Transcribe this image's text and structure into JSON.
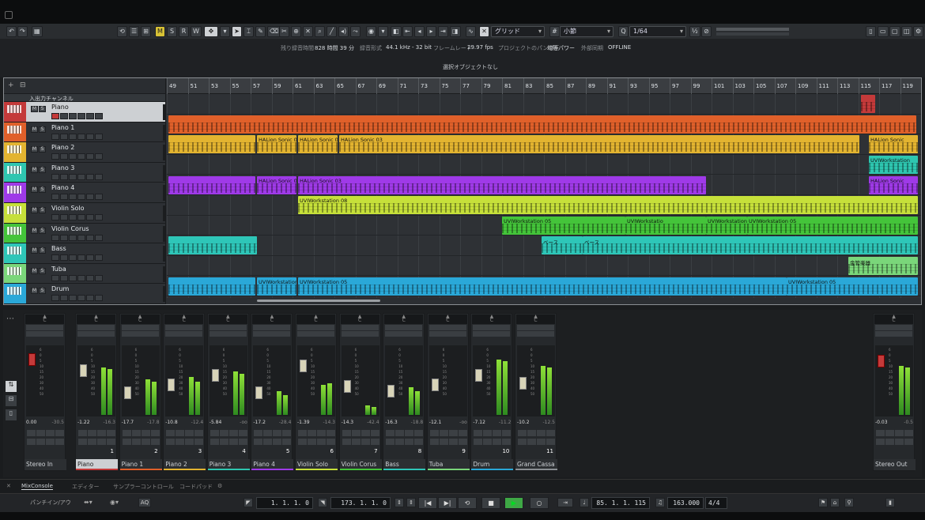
{
  "toolbar": {
    "mode_m": "M",
    "mode_s": "S",
    "mode_r": "R",
    "mode_w": "W",
    "snap_type": "グリッド",
    "grid_type": "小節",
    "quantize": "1/64"
  },
  "info": {
    "rec_time_label": "残り録音時間",
    "rec_time_value": "828 時間 39 分",
    "rec_format_label": "録音形式",
    "rec_format_value": "44.1 kHz - 32 bit",
    "frame_rate_label": "フレームレート",
    "frame_rate_value": "29.97 fps",
    "pan_label": "プロジェクトのパン補正",
    "pan_value": "均等パワー",
    "sync_label": "外部同期",
    "sync_value": "OFFLINE"
  },
  "status": {
    "message": "選択オブジェクトなし"
  },
  "project": {
    "folder_label": "入出力チャンネル",
    "tracks": [
      {
        "name": "Piano",
        "color": "#c43a3a"
      },
      {
        "name": "Piano 1",
        "color": "#e0602a"
      },
      {
        "name": "Piano 2",
        "color": "#e3b430"
      },
      {
        "name": "Piano 3",
        "color": "#2ec6b0"
      },
      {
        "name": "Piano 4",
        "color": "#9f3ae8"
      },
      {
        "name": "Violin Solo",
        "color": "#c6e03a"
      },
      {
        "name": "Violin Corus",
        "color": "#44c43a"
      },
      {
        "name": "Bass",
        "color": "#2ec6b8"
      },
      {
        "name": "Tuba",
        "color": "#7ad67a"
      },
      {
        "name": "Drum",
        "color": "#2aa8d8"
      }
    ],
    "bars": [
      "49",
      "51",
      "53",
      "55",
      "57",
      "59",
      "61",
      "63",
      "65",
      "67",
      "69",
      "71",
      "73",
      "75",
      "77",
      "79",
      "81",
      "83",
      "85",
      "87",
      "89",
      "91",
      "93",
      "95",
      "97",
      "99",
      "101",
      "103",
      "105",
      "107",
      "109",
      "111",
      "113",
      "115",
      "117",
      "119"
    ],
    "event_labels": {
      "halion0": "HALion Sonic 0",
      "halion03": "HALion Sonic 03",
      "halion0short": "HALion Sonic 0",
      "halionsonic": "HALion Sonic",
      "uvi08": "UVIWorkstation 08",
      "uvi05": "UVIWorkstation 05",
      "uvi05b": "UVIWorkstatio",
      "uvi05c": "UVIWorkstation 05",
      "uvi05d": "UVIWorkstation 05",
      "uvi_cut": "UVIWorkstation",
      "bass1": "ベース",
      "bass2": "ベース",
      "tuba": "金管楽器"
    }
  },
  "mixer": {
    "strips": [
      {
        "name": "Stereo In",
        "num": "",
        "val": "0.00",
        "peak": "-30.5",
        "color": "#2c2f32",
        "textcolor": "#aaa"
      },
      {
        "name": "Piano",
        "num": "1",
        "val": "-1.22",
        "peak": "-16.3",
        "color": "#cdd0d3",
        "bar": "#c43a3a"
      },
      {
        "name": "Piano 1",
        "num": "2",
        "val": "-17.7",
        "peak": "-17.8",
        "color": "#2c2f32",
        "bar": "#e0602a"
      },
      {
        "name": "Piano 2",
        "num": "3",
        "val": "-10.8",
        "peak": "-12.4",
        "color": "#2c2f32",
        "bar": "#e3b430"
      },
      {
        "name": "Piano 3",
        "num": "4",
        "val": "-5.84",
        "peak": "-oo",
        "color": "#2c2f32",
        "bar": "#2ec6b0"
      },
      {
        "name": "Piano 4",
        "num": "5",
        "val": "-17.2",
        "peak": "-28.4",
        "color": "#2c2f32",
        "bar": "#9f3ae8"
      },
      {
        "name": "Violin Solo",
        "num": "6",
        "val": "-1.39",
        "peak": "-14.3",
        "color": "#2c2f32",
        "bar": "#c6e03a"
      },
      {
        "name": "Violin Corus",
        "num": "7",
        "val": "-14.3",
        "peak": "-42.4",
        "color": "#2c2f32",
        "bar": "#44c43a"
      },
      {
        "name": "Bass",
        "num": "8",
        "val": "-16.3",
        "peak": "-18.8",
        "color": "#2c2f32",
        "bar": "#2ec6b8"
      },
      {
        "name": "Tuba",
        "num": "9",
        "val": "-12.1",
        "peak": "-oo",
        "color": "#2c2f32",
        "bar": "#7ad67a"
      },
      {
        "name": "Drum",
        "num": "10",
        "val": "-7.12",
        "peak": "-11.2",
        "color": "#2c2f32",
        "bar": "#2aa8d8"
      },
      {
        "name": "Grand Cassa",
        "num": "11",
        "val": "-10.2",
        "peak": "-12.5",
        "color": "#2c2f32",
        "bar": "#8a8e92"
      }
    ],
    "out": {
      "name": "Stereo Out",
      "val": "-0.03",
      "peak": "-0.5"
    }
  },
  "tabs": [
    "MixConsole",
    "エディター",
    "サンプラーコントロール",
    "コードパッド"
  ],
  "transport": {
    "left_locator": "1. 1. 1.   0",
    "right_locator": "173. 1. 1.   0",
    "position": "85. 1. 1. 115",
    "tempo": "163.000",
    "signature": "4/4",
    "punch_label": "パンチイン/アウ",
    "aq": "AQ"
  }
}
